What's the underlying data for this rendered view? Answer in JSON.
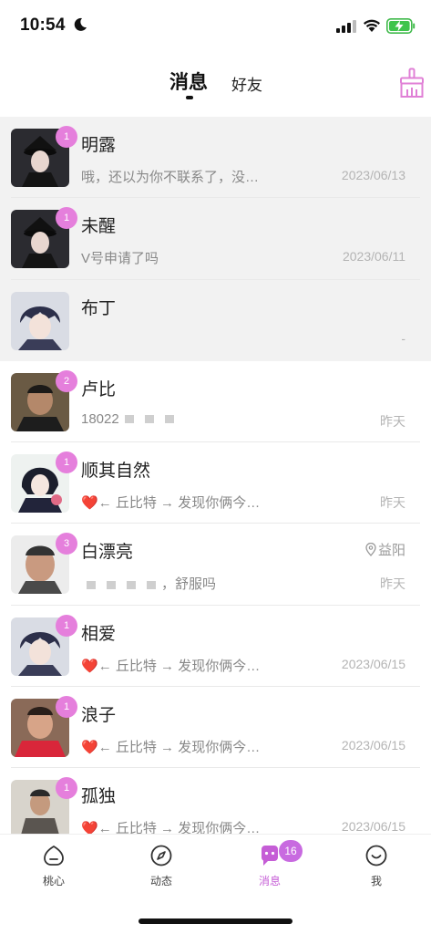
{
  "status_bar": {
    "time": "10:54"
  },
  "header": {
    "tabs": [
      {
        "label": "消息",
        "active": true
      },
      {
        "label": "好友",
        "active": false
      }
    ],
    "clean_icon": "broom-icon"
  },
  "conversations": [
    {
      "name": "明露",
      "badge": "1",
      "preview": "哦，还以为你不联系了，没…",
      "time": "2023/06/13",
      "pinned": true
    },
    {
      "name": "未醒",
      "badge": "1",
      "preview": "V号申请了吗",
      "time": "2023/06/11",
      "pinned": true
    },
    {
      "name": "布丁",
      "badge": "",
      "preview": "",
      "time": "-",
      "pinned": true
    },
    {
      "name": "卢比",
      "badge": "2",
      "preview": "18022",
      "time": "昨天",
      "pinned": false
    },
    {
      "name": "顺其自然",
      "badge": "1",
      "preview": "← 丘比特 → 发现你俩今…",
      "time": "昨天",
      "pinned": false
    },
    {
      "name": "白漂亮",
      "badge": "3",
      "preview": "，舒服吗",
      "time": "昨天",
      "location": "益阳",
      "pinned": false
    },
    {
      "name": "相爱",
      "badge": "1",
      "preview": "← 丘比特 → 发现你俩今…",
      "time": "2023/06/15",
      "pinned": false
    },
    {
      "name": "浪子",
      "badge": "1",
      "preview": "← 丘比特 → 发现你俩今…",
      "time": "2023/06/15",
      "pinned": false
    },
    {
      "name": "孤独",
      "badge": "1",
      "preview": "← 丘比特 → 发现你俩今…",
      "time": "2023/06/15",
      "pinned": false
    }
  ],
  "bottom_nav": [
    {
      "label": "桃心",
      "icon": "peach-icon",
      "active": false
    },
    {
      "label": "动态",
      "icon": "compass-icon",
      "active": false
    },
    {
      "label": "消息",
      "icon": "chat-bubble-icon",
      "active": true,
      "badge": "16"
    },
    {
      "label": "我",
      "icon": "smile-face-icon",
      "active": false
    }
  ],
  "colors": {
    "accent": "#c55dd6",
    "badge": "#e57fdc",
    "heart": "#d9161c",
    "pinned_bg": "#f2f2f2"
  }
}
